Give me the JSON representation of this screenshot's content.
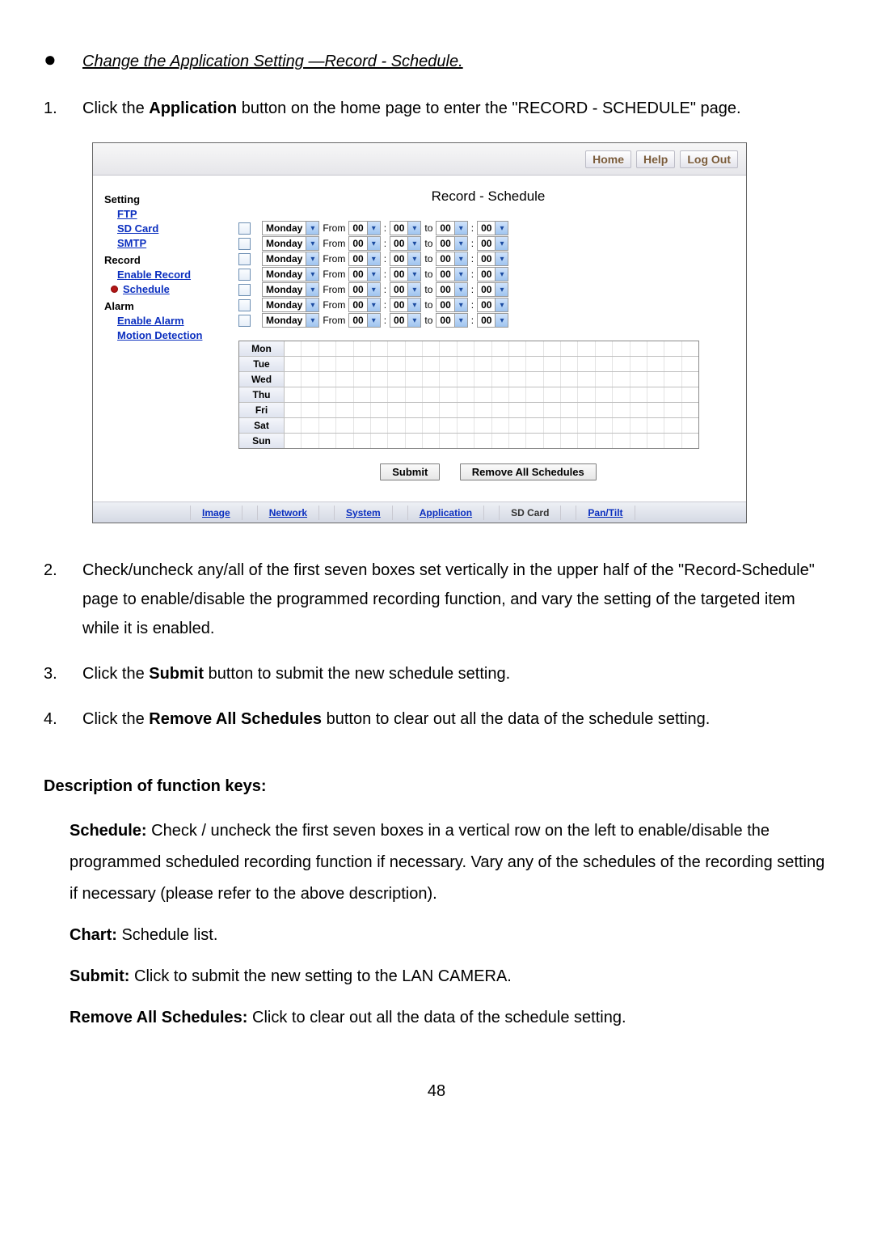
{
  "heading": {
    "bullet": "●",
    "title": "Change the Application Setting —Record - Schedule."
  },
  "steps_top": [
    {
      "num": "1.",
      "before": "Click the ",
      "bold": "Application",
      "after": " button on the home page to enter the \"RECORD - SCHEDULE\" page."
    }
  ],
  "screenshot": {
    "bar": {
      "home": "Home",
      "help": "Help",
      "logout": "Log Out"
    },
    "sidebar": {
      "setting": "Setting",
      "ftp": "FTP",
      "sdcard": "SD Card",
      "smtp": "SMTP",
      "record": "Record",
      "enable_record": "Enable Record",
      "schedule": "Schedule",
      "alarm": "Alarm",
      "enable_alarm": "Enable Alarm",
      "motion": "Motion Detection"
    },
    "content": {
      "title": "Record - Schedule",
      "rows_count": 7,
      "row": {
        "day": "Monday",
        "from": "From",
        "colon": ":",
        "to": "to",
        "hh": "00",
        "mm": "00"
      },
      "days": [
        "Mon",
        "Tue",
        "Wed",
        "Thu",
        "Fri",
        "Sat",
        "Sun"
      ],
      "btn_submit": "Submit",
      "btn_remove": "Remove All Schedules"
    },
    "tabs": {
      "image": "Image",
      "network": "Network",
      "system": "System",
      "application": "Application",
      "sdcard": "SD Card",
      "pantilt": "Pan/Tilt"
    }
  },
  "steps_bottom": [
    {
      "num": "2.",
      "text": "Check/uncheck any/all of the first seven boxes set vertically in the upper half of the \"Record-Schedule\" page to enable/disable the programmed recording function, and vary the setting of the targeted item while it is enabled."
    },
    {
      "num": "3.",
      "before": "Click the ",
      "bold": "Submit",
      "after": " button to submit the new schedule setting."
    },
    {
      "num": "4.",
      "before": "Click the ",
      "bold": "Remove All Schedules",
      "after": " button to clear out all the data of the schedule setting."
    }
  ],
  "desc": {
    "heading": "Description of function keys:",
    "items": [
      {
        "k": "Schedule:",
        "t": " Check / uncheck the first seven boxes in a vertical row on the left to enable/disable the programmed scheduled recording function if necessary. Vary any of the schedules of the recording setting if necessary (please refer to the above description)."
      },
      {
        "k": "Chart:",
        "t": " Schedule list."
      },
      {
        "k": "Submit:",
        "t": " Click to submit the new setting to the LAN CAMERA."
      },
      {
        "k": "Remove All Schedules:",
        "t": " Click to clear out all the data of the schedule setting."
      }
    ]
  },
  "page_number": "48"
}
